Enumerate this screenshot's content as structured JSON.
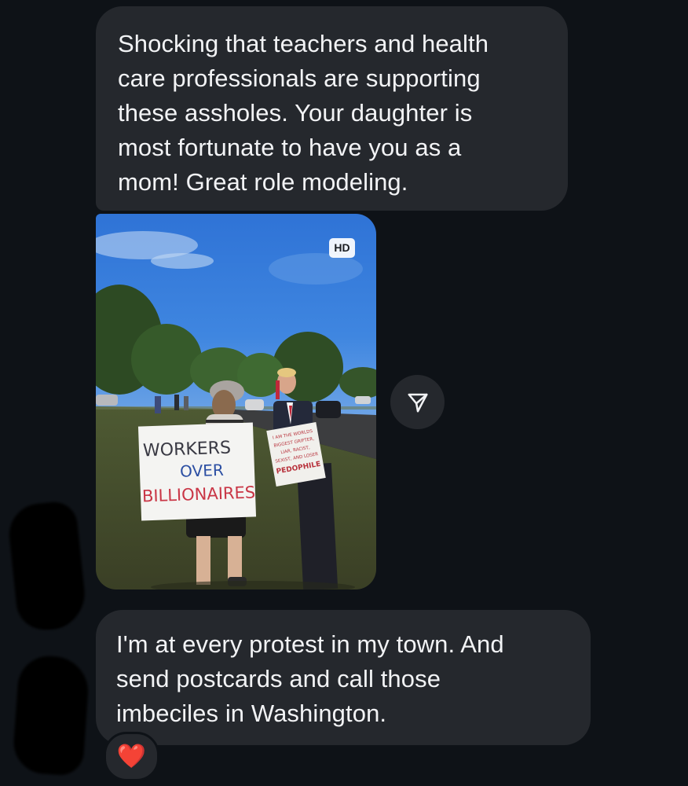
{
  "messages": [
    {
      "direction": "incoming",
      "text": "Shocking that teachers and health\ncare professionals are supporting\nthese assholes. Your daughter is\nmost fortunate to have you as a\nmom! Great role modeling."
    },
    {
      "direction": "incoming",
      "type": "photo",
      "badge": "HD",
      "sign_left": [
        "WORKERS",
        "OVER",
        "BILLIONAIRES"
      ],
      "sign_right": [
        "I AM THE WORLDS",
        "BIGGEST GRIFTER,",
        "LIAR, RACIST,",
        "SEXIST, AND LOSER",
        "PEDOPHILE"
      ]
    },
    {
      "direction": "incoming",
      "text": "I'm at every protest in my town. And\nsend postcards and call those\nimbeciles in Washington.",
      "reaction": "❤️"
    }
  ],
  "icons": {
    "share": "paper-plane-icon",
    "reaction": "heart-icon"
  },
  "colors": {
    "background": "#0e1217",
    "bubble": "#25282d",
    "text": "#f2f3f5"
  }
}
